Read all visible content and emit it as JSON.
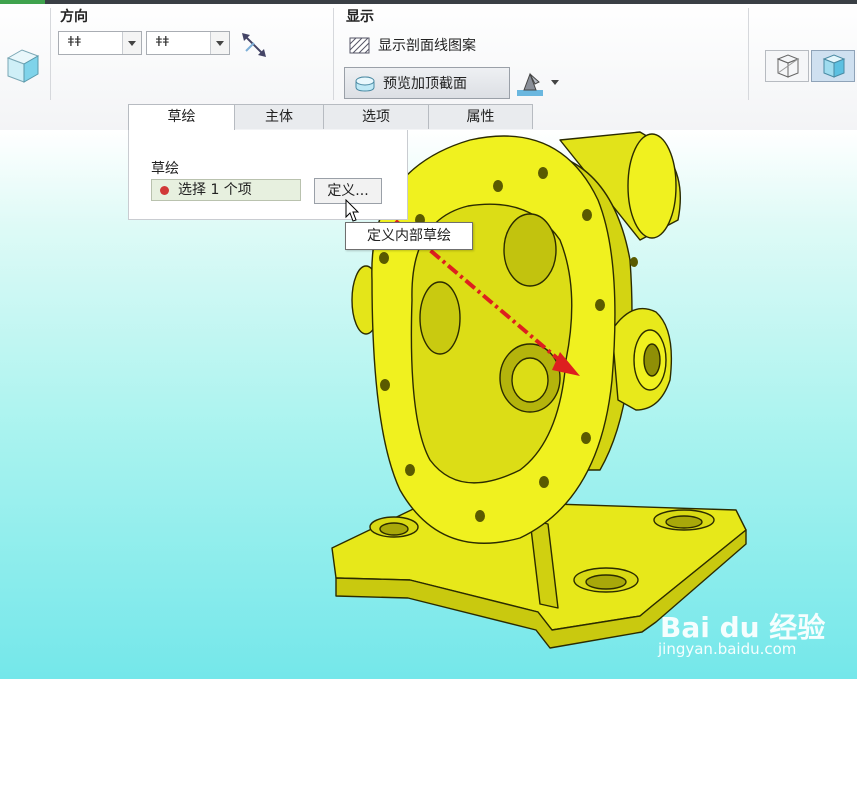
{
  "ribbon": {
    "direction_group": {
      "title": "方向",
      "combo1_glyph": "ǂǂ",
      "combo2_glyph": "ǂǂ"
    },
    "display_group": {
      "title": "显示",
      "show_hatch_label": "显示剖面线图案",
      "preview_top_cut_label": "预览加顶截面"
    }
  },
  "tabs": [
    {
      "label": "草绘",
      "active": true
    },
    {
      "label": "主体",
      "active": false
    },
    {
      "label": "选项",
      "active": false
    },
    {
      "label": "属性",
      "active": false
    }
  ],
  "sketch_panel": {
    "title": "草绘",
    "collector_text": "选择 1 个项",
    "define_button": "定义...",
    "tooltip": "定义内部草绘"
  },
  "watermark": {
    "brand": "Bai du 经验",
    "url": "jingyan.baidu.com"
  },
  "colors": {
    "model": "#f1f21b",
    "annotation": "#dd1f1f",
    "viewport_bottom": "#74e7ea"
  }
}
